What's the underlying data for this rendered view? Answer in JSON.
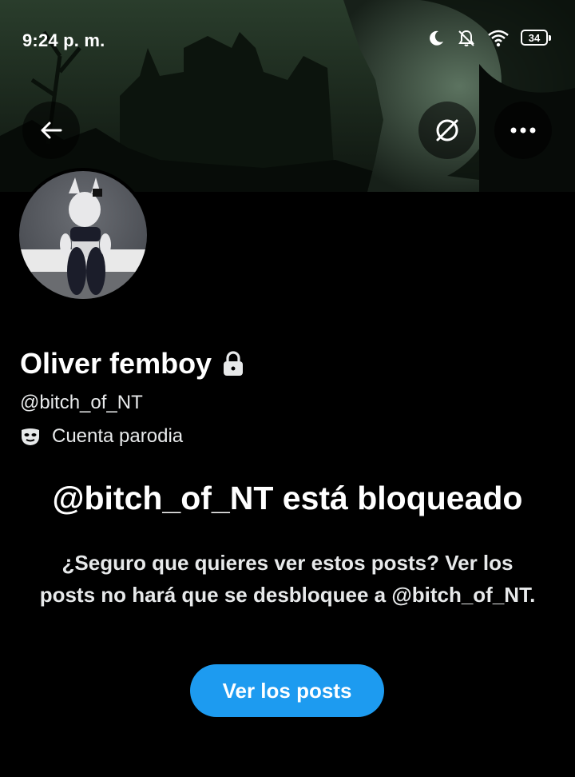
{
  "status_bar": {
    "time": "9:24 p. m.",
    "battery_level": "34",
    "icons": [
      "moon-icon",
      "bell-off-icon",
      "wifi-icon",
      "battery-icon"
    ]
  },
  "header": {
    "back_icon": "arrow-left-icon",
    "grok_icon": "grok-icon",
    "more_icon": "more-dots-icon"
  },
  "profile": {
    "display_name": "Oliver femboy",
    "protected_icon": "lock-icon",
    "handle": "@bitch_of_NT",
    "parody_icon": "mask-icon",
    "parody_label": "Cuenta parodia"
  },
  "blocked": {
    "title": "@bitch_of_NT está bloqueado",
    "description": "¿Seguro que quieres ver estos posts? Ver los posts no hará que se desbloquee a @bitch_of_NT.",
    "button_label": "Ver los posts"
  },
  "colors": {
    "background": "#000000",
    "accent": "#1d9bf0",
    "text": "#e7e9ea"
  }
}
